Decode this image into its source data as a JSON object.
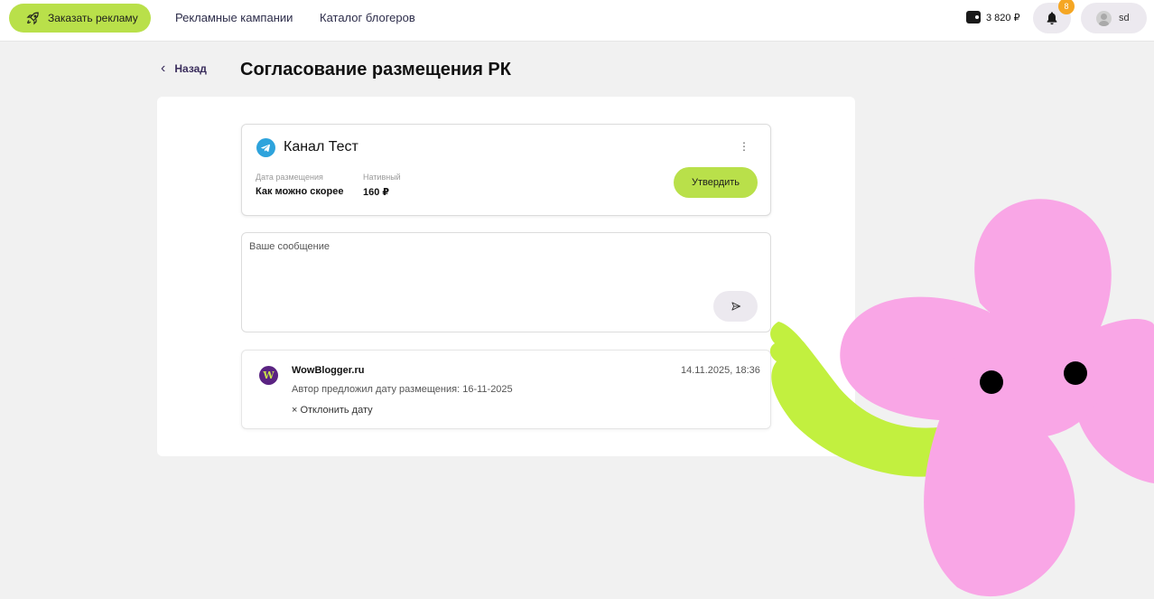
{
  "topbar": {
    "order_label": "Заказать рекламу",
    "nav": [
      "Рекламные кампании",
      "Каталог блогеров"
    ],
    "balance": "3 820 ₽",
    "notifications_count": "8",
    "username": "sd"
  },
  "page": {
    "back_label": "Назад",
    "title": "Согласование размещения РК"
  },
  "channel": {
    "name": "Канал Тест",
    "date_label": "Дата размещения",
    "date_value": "Как можно скорее",
    "format_label": "Нативный",
    "price": "160 ₽",
    "approve_label": "Утвердить"
  },
  "message": {
    "placeholder": "Ваше сообщение"
  },
  "event": {
    "author": "WowBlogger.ru",
    "logo_letter": "W",
    "timestamp": "14.11.2025, 18:36",
    "text": "Автор предложил дату размещения: 16-11-2025",
    "reject_label": "Отклонить дату"
  },
  "icons": {
    "order": "rocket-icon",
    "wallet": "wallet-icon",
    "bell": "bell-icon",
    "avatar": "user-avatar-icon",
    "back": "chevron-left-icon",
    "channel": "telegram-icon",
    "more": "kebab-menu-icon",
    "send": "send-icon",
    "reject": "close-icon"
  },
  "colors": {
    "accent": "#b9e04a",
    "background": "#f1f1f1",
    "telegram": "#2ea3dc",
    "badge": "#f5a623",
    "mascot_pink": "#f9a6e6",
    "mascot_green": "#c2f03f"
  }
}
